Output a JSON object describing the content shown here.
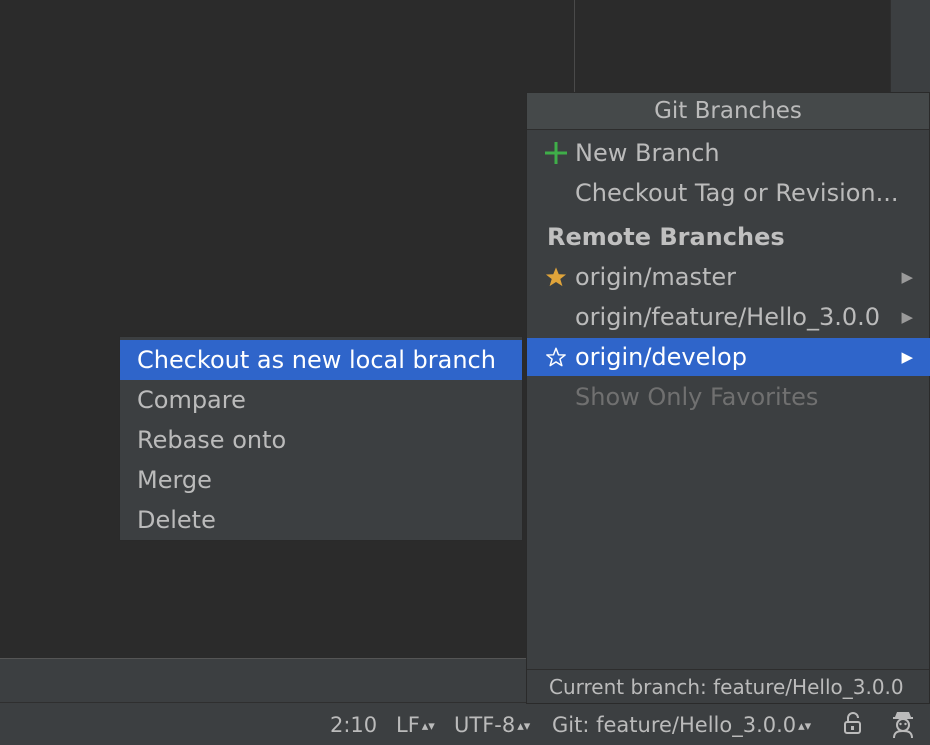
{
  "popup": {
    "title": "Git Branches",
    "new_branch": "New Branch",
    "checkout_tag": "Checkout Tag or Revision...",
    "section_remote": "Remote Branches",
    "remote_branches": [
      {
        "label": "origin/master",
        "icon": "star-filled-icon"
      },
      {
        "label": "origin/feature/Hello_3.0.0",
        "icon": ""
      },
      {
        "label": "origin/develop",
        "icon": "star-outline-icon"
      }
    ],
    "show_only_favorites": "Show Only Favorites",
    "footer": "Current branch: feature/Hello_3.0.0"
  },
  "submenu": {
    "items": [
      "Checkout as new local branch",
      "Compare",
      "Rebase onto",
      "Merge",
      "Delete"
    ]
  },
  "statusbar": {
    "position": "2:10",
    "line_separator": "LF",
    "encoding": "UTF-8",
    "vcs_branch": "Git: feature/Hello_3.0.0"
  },
  "colors": {
    "selection": "#2f65ca",
    "plus_green": "#3fae49",
    "star_gold": "#e0a43a"
  }
}
